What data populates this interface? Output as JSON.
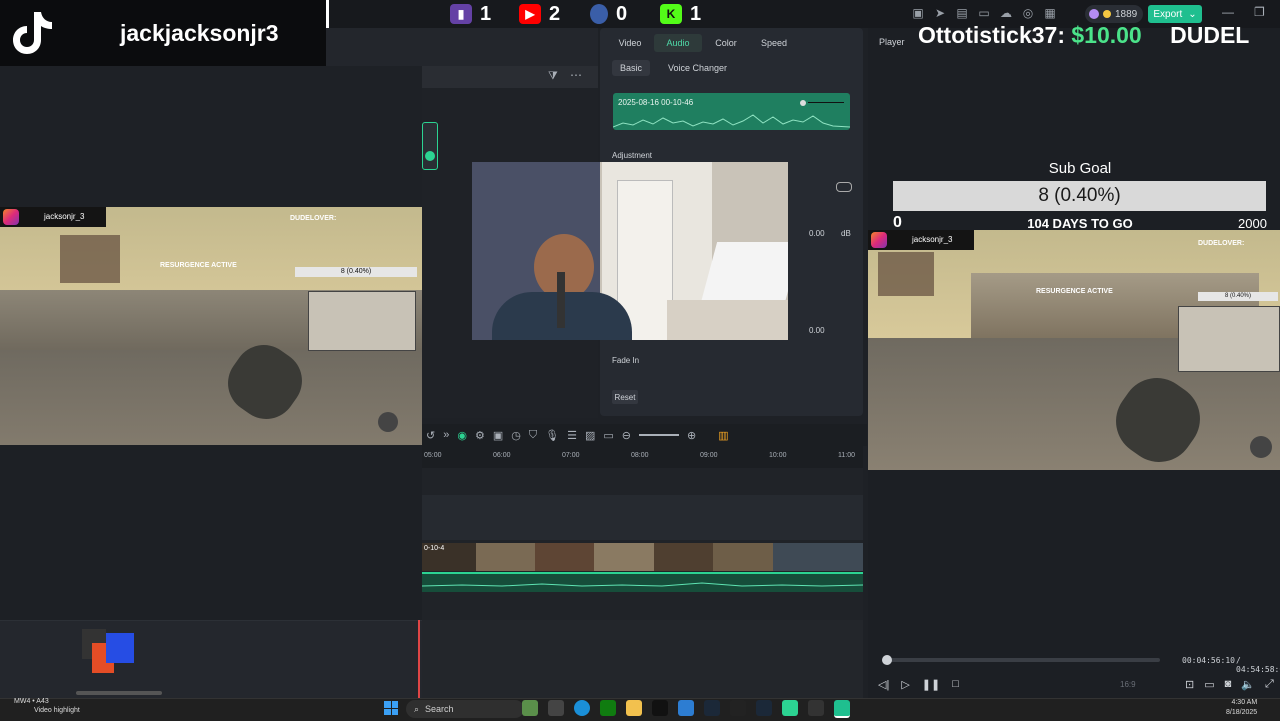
{
  "tiktok": {
    "username": "jackjacksonjr3"
  },
  "platforms": [
    {
      "name": "twitch-icon",
      "count": "1",
      "color": "#6441a5"
    },
    {
      "name": "youtube-icon",
      "count": "2",
      "color": "#ff0000"
    },
    {
      "name": "ubisoft-icon",
      "count": "0",
      "color": "#3a5ea8"
    },
    {
      "name": "kick-icon",
      "count": "1",
      "color": "#53fc18"
    }
  ],
  "app": {
    "credits": "1889",
    "export_label": "Export"
  },
  "audio_panel": {
    "tabs": [
      "Video",
      "Audio",
      "Color",
      "Speed"
    ],
    "active_tab": "Audio",
    "subtabs": [
      "Basic",
      "Voice Changer"
    ],
    "clip_name": "2025-08-16 00-10-46",
    "adjustment_label": "Adjustment",
    "db_value": "0.00",
    "db_unit": "dB",
    "value2": "0.00",
    "fade_in_label": "Fade In",
    "reset_label": "Reset"
  },
  "timeline": {
    "ticks": [
      "05:00",
      "06:00",
      "07:00",
      "08:00",
      "09:00",
      "10:00",
      "11:00"
    ],
    "clip_label": "0-10-4"
  },
  "player": {
    "label": "Player",
    "current_time": "00:04:56:10",
    "total_time": "/ 04:54:58:0",
    "ratio": "16:9"
  },
  "stream_overlay": {
    "donor": "Ottotistick37:",
    "donation_amount": "$10.00",
    "ticker_next": "DUDEL",
    "sub_goal_title": "Sub Goal",
    "sub_goal_value": "8 (0.40%)",
    "goal_min": "0",
    "goal_days": "104 DAYS TO GO",
    "goal_max": "2000",
    "clip_username": "jacksonjr_3",
    "clip_username_right": "jacksonjr_3",
    "resurgence_text": "RESURGENCE ACTIVE",
    "mini_goal": "8 (0.40%)",
    "mini_donor": "DUDELOVER:"
  },
  "taskbar": {
    "search_placeholder": "Search",
    "notification_title": "MW4 • A43",
    "notification_sub": "Video highlight",
    "time": "4:30 AM",
    "date": "8/18/2025"
  },
  "colors": {
    "accent_green": "#1fbf8f",
    "waveform_green": "#1f7f60",
    "donation_green": "#4be38a",
    "playhead_red": "#e04646"
  }
}
